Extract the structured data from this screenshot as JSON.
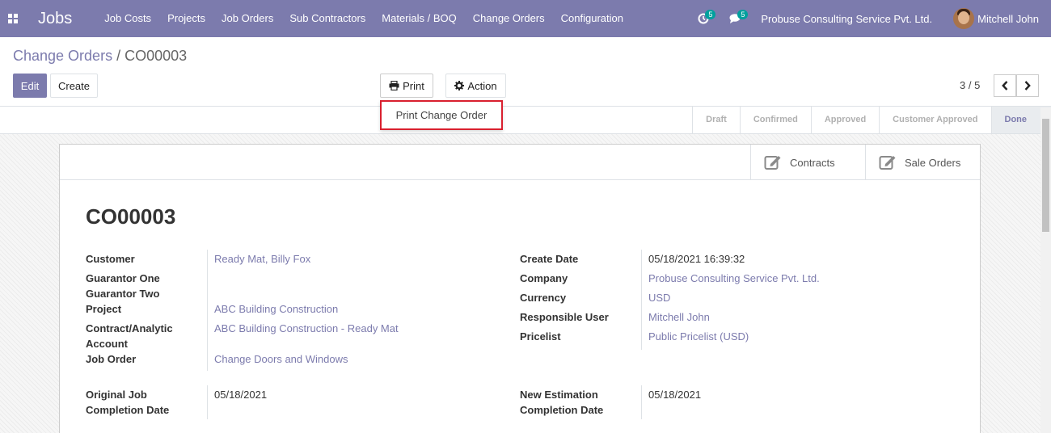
{
  "navbar": {
    "brand": "Jobs",
    "menu": [
      "Job Costs",
      "Projects",
      "Job Orders",
      "Sub Contractors",
      "Materials / BOQ",
      "Change Orders",
      "Configuration"
    ],
    "activity_count": "5",
    "messages_count": "5",
    "company": "Probuse Consulting Service Pvt. Ltd.",
    "user": "Mitchell John"
  },
  "breadcrumb": {
    "parent": "Change Orders",
    "separator": " / ",
    "current": "CO00003"
  },
  "toolbar": {
    "edit": "Edit",
    "create": "Create",
    "print": "Print",
    "action": "Action"
  },
  "print_menu": {
    "item": "Print Change Order"
  },
  "pager": {
    "value": "3 / 5"
  },
  "stages": [
    "Draft",
    "Confirmed",
    "Approved",
    "Customer Approved",
    "Done"
  ],
  "active_stage": "Done",
  "smart_buttons": {
    "contracts": "Contracts",
    "sale_orders": "Sale Orders"
  },
  "record": {
    "name": "CO00003",
    "left": {
      "customer_label": "Customer",
      "customer": "Ready Mat, Billy Fox",
      "guarantor_one_label": "Guarantor One",
      "guarantor_two_label": "Guarantor Two",
      "project_label": "Project",
      "project": "ABC Building Construction",
      "contract_label_1": "Contract/Analytic",
      "contract_label_2": "Account",
      "contract": "ABC Building Construction - Ready Mat",
      "job_order_label": "Job Order",
      "job_order": "Change Doors and Windows",
      "original_label_1": "Original Job",
      "original_label_2": "Completion Date",
      "original_date": "05/18/2021"
    },
    "right": {
      "create_date_label": "Create Date",
      "create_date": "05/18/2021 16:39:32",
      "company_label": "Company",
      "company": "Probuse Consulting Service Pvt. Ltd.",
      "currency_label": "Currency",
      "currency": "USD",
      "responsible_label": "Responsible User",
      "responsible": "Mitchell John",
      "pricelist_label": "Pricelist",
      "pricelist": "Public Pricelist (USD)",
      "new_est_label_1": "New Estimation",
      "new_est_label_2": "Completion Date",
      "new_est_date": "05/18/2021"
    }
  }
}
